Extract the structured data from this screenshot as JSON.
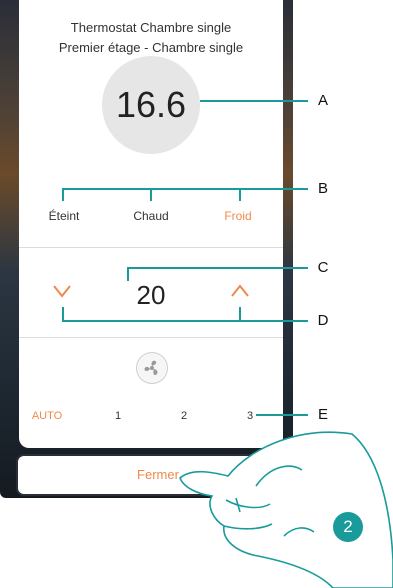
{
  "header": {
    "title": "Thermostat Chambre single",
    "subtitle": "Premier étage - Chambre single"
  },
  "temperature": {
    "current": "16.6"
  },
  "modes": [
    {
      "label": "Éteint",
      "active": false
    },
    {
      "label": "Chaud",
      "active": false
    },
    {
      "label": "Froid",
      "active": true
    }
  ],
  "setpoint": {
    "value": "20"
  },
  "fan": {
    "icon": "fan-icon",
    "options": [
      {
        "label": "AUTO",
        "active": true
      },
      {
        "label": "1",
        "active": false
      },
      {
        "label": "2",
        "active": false
      },
      {
        "label": "3",
        "active": false
      }
    ]
  },
  "close_button": {
    "label": "Fermer"
  },
  "callouts": [
    "A",
    "B",
    "C",
    "D",
    "E"
  ],
  "step_badge": "2",
  "colors": {
    "accent": "#f08a4b",
    "callout_line": "#1a9b9b",
    "badge": "#1a9b9b"
  }
}
